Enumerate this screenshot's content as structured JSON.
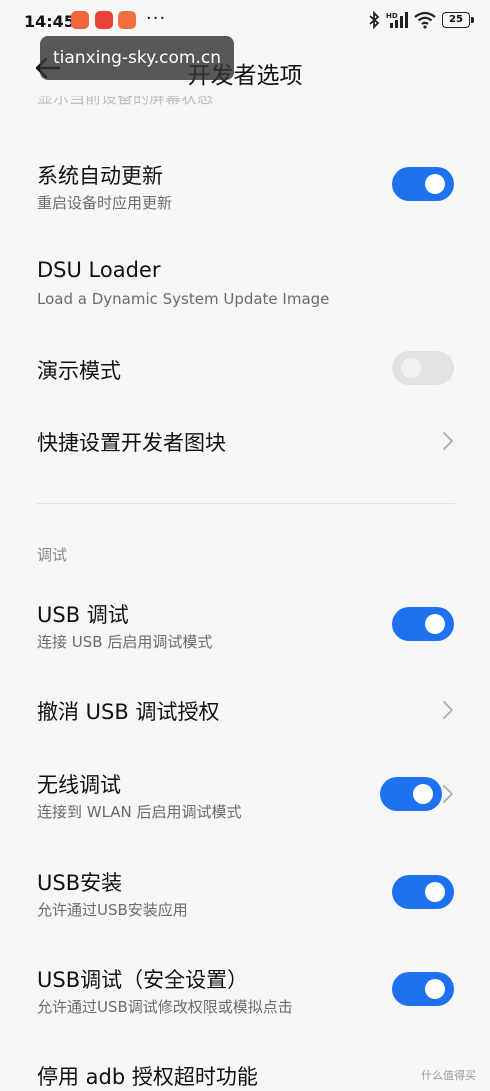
{
  "status_bar": {
    "time": "14:45",
    "more": "···",
    "battery": "25"
  },
  "header": {
    "back_icon": "arrow-left-icon",
    "title": "开发者选项"
  },
  "watermark": "tianxing-sky.com.cn",
  "truncated_row_text": "显示当前设备的屏幕状态",
  "rows": {
    "system_update": {
      "title": "系统自动更新",
      "subtitle": "重启设备时应用更新",
      "toggle": "on"
    },
    "dsu_loader": {
      "title": "DSU Loader",
      "subtitle": "Load a Dynamic System Update Image"
    },
    "demo_mode": {
      "title": "演示模式",
      "toggle": "disabled"
    },
    "quick_tiles": {
      "title": "快捷设置开发者图块"
    },
    "section_debug": "调试",
    "usb_debug": {
      "title": "USB 调试",
      "subtitle": "连接 USB 后启用调试模式",
      "toggle": "on"
    },
    "revoke_usb": {
      "title": "撤消 USB 调试授权"
    },
    "wireless_debug": {
      "title": "无线调试",
      "subtitle": "连接到 WLAN 后启用调试模式",
      "toggle": "on"
    },
    "usb_install": {
      "title": "USB安装",
      "subtitle": "允许通过USB安装应用",
      "toggle": "on"
    },
    "usb_debug_security": {
      "title": "USB调试（安全设置）",
      "subtitle": "允许通过USB调试修改权限或模拟点击",
      "toggle": "on"
    },
    "adb_timeout": {
      "title": "停用 adb 授权超时功能"
    }
  },
  "corner_watermark": "什么值得买",
  "colors": {
    "accent": "#1f72ef",
    "background": "#f7f7f7",
    "toggle_off": "#e2e2e2"
  }
}
